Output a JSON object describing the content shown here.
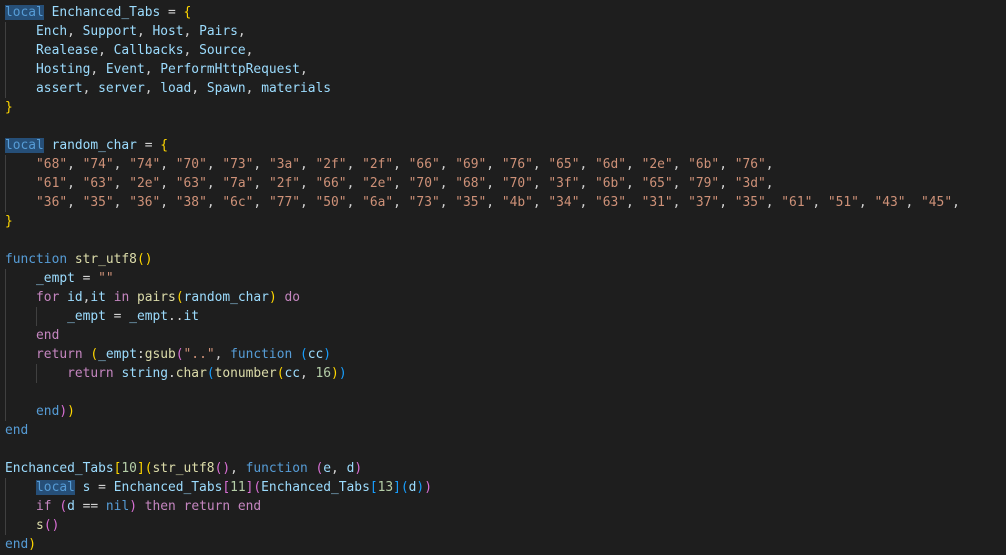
{
  "editor": {
    "lines": [
      [
        [
          "local",
          "kw hl"
        ],
        [
          " ",
          ""
        ],
        [
          "Enchanced_Tabs",
          "var"
        ],
        [
          " = ",
          ""
        ],
        [
          "{",
          "b1"
        ]
      ],
      [
        [
          "    ",
          ""
        ],
        [
          "Ench",
          "var"
        ],
        [
          ", ",
          ""
        ],
        [
          "Support",
          "var"
        ],
        [
          ", ",
          ""
        ],
        [
          "Host",
          "var"
        ],
        [
          ", ",
          ""
        ],
        [
          "Pairs",
          "var"
        ],
        [
          ",",
          ""
        ]
      ],
      [
        [
          "    ",
          ""
        ],
        [
          "Realease",
          "var"
        ],
        [
          ", ",
          ""
        ],
        [
          "Callbacks",
          "var"
        ],
        [
          ", ",
          ""
        ],
        [
          "Source",
          "var"
        ],
        [
          ",",
          ""
        ]
      ],
      [
        [
          "    ",
          ""
        ],
        [
          "Hosting",
          "var"
        ],
        [
          ", ",
          ""
        ],
        [
          "Event",
          "var"
        ],
        [
          ", ",
          ""
        ],
        [
          "PerformHttpRequest",
          "var"
        ],
        [
          ",",
          ""
        ]
      ],
      [
        [
          "    ",
          ""
        ],
        [
          "assert",
          "var"
        ],
        [
          ", ",
          ""
        ],
        [
          "server",
          "var"
        ],
        [
          ", ",
          ""
        ],
        [
          "load",
          "var"
        ],
        [
          ", ",
          ""
        ],
        [
          "Spawn",
          "var"
        ],
        [
          ", ",
          ""
        ],
        [
          "materials",
          "var"
        ]
      ],
      [
        [
          "}",
          "b1"
        ]
      ],
      [],
      [
        [
          "local",
          "kw hl"
        ],
        [
          " ",
          ""
        ],
        [
          "random_char",
          "var"
        ],
        [
          " = ",
          ""
        ],
        [
          "{",
          "b1"
        ]
      ],
      [
        [
          "    ",
          ""
        ],
        [
          "\"68\"",
          "str"
        ],
        [
          ", ",
          ""
        ],
        [
          "\"74\"",
          "str"
        ],
        [
          ", ",
          ""
        ],
        [
          "\"74\"",
          "str"
        ],
        [
          ", ",
          ""
        ],
        [
          "\"70\"",
          "str"
        ],
        [
          ", ",
          ""
        ],
        [
          "\"73\"",
          "str"
        ],
        [
          ", ",
          ""
        ],
        [
          "\"3a\"",
          "str"
        ],
        [
          ", ",
          ""
        ],
        [
          "\"2f\"",
          "str"
        ],
        [
          ", ",
          ""
        ],
        [
          "\"2f\"",
          "str"
        ],
        [
          ", ",
          ""
        ],
        [
          "\"66\"",
          "str"
        ],
        [
          ", ",
          ""
        ],
        [
          "\"69\"",
          "str"
        ],
        [
          ", ",
          ""
        ],
        [
          "\"76\"",
          "str"
        ],
        [
          ", ",
          ""
        ],
        [
          "\"65\"",
          "str"
        ],
        [
          ", ",
          ""
        ],
        [
          "\"6d\"",
          "str"
        ],
        [
          ", ",
          ""
        ],
        [
          "\"2e\"",
          "str"
        ],
        [
          ", ",
          ""
        ],
        [
          "\"6b\"",
          "str"
        ],
        [
          ", ",
          ""
        ],
        [
          "\"76\"",
          "str"
        ],
        [
          ",",
          ""
        ]
      ],
      [
        [
          "    ",
          ""
        ],
        [
          "\"61\"",
          "str"
        ],
        [
          ", ",
          ""
        ],
        [
          "\"63\"",
          "str"
        ],
        [
          ", ",
          ""
        ],
        [
          "\"2e\"",
          "str"
        ],
        [
          ", ",
          ""
        ],
        [
          "\"63\"",
          "str"
        ],
        [
          ", ",
          ""
        ],
        [
          "\"7a\"",
          "str"
        ],
        [
          ", ",
          ""
        ],
        [
          "\"2f\"",
          "str"
        ],
        [
          ", ",
          ""
        ],
        [
          "\"66\"",
          "str"
        ],
        [
          ", ",
          ""
        ],
        [
          "\"2e\"",
          "str"
        ],
        [
          ", ",
          ""
        ],
        [
          "\"70\"",
          "str"
        ],
        [
          ", ",
          ""
        ],
        [
          "\"68\"",
          "str"
        ],
        [
          ", ",
          ""
        ],
        [
          "\"70\"",
          "str"
        ],
        [
          ", ",
          ""
        ],
        [
          "\"3f\"",
          "str"
        ],
        [
          ", ",
          ""
        ],
        [
          "\"6b\"",
          "str"
        ],
        [
          ", ",
          ""
        ],
        [
          "\"65\"",
          "str"
        ],
        [
          ", ",
          ""
        ],
        [
          "\"79\"",
          "str"
        ],
        [
          ", ",
          ""
        ],
        [
          "\"3d\"",
          "str"
        ],
        [
          ",",
          ""
        ]
      ],
      [
        [
          "    ",
          ""
        ],
        [
          "\"36\"",
          "str"
        ],
        [
          ", ",
          ""
        ],
        [
          "\"35\"",
          "str"
        ],
        [
          ", ",
          ""
        ],
        [
          "\"36\"",
          "str"
        ],
        [
          ", ",
          ""
        ],
        [
          "\"38\"",
          "str"
        ],
        [
          ", ",
          ""
        ],
        [
          "\"6c\"",
          "str"
        ],
        [
          ", ",
          ""
        ],
        [
          "\"77\"",
          "str"
        ],
        [
          ", ",
          ""
        ],
        [
          "\"50\"",
          "str"
        ],
        [
          ", ",
          ""
        ],
        [
          "\"6a\"",
          "str"
        ],
        [
          ", ",
          ""
        ],
        [
          "\"73\"",
          "str"
        ],
        [
          ", ",
          ""
        ],
        [
          "\"35\"",
          "str"
        ],
        [
          ", ",
          ""
        ],
        [
          "\"4b\"",
          "str"
        ],
        [
          ", ",
          ""
        ],
        [
          "\"34\"",
          "str"
        ],
        [
          ", ",
          ""
        ],
        [
          "\"63\"",
          "str"
        ],
        [
          ", ",
          ""
        ],
        [
          "\"31\"",
          "str"
        ],
        [
          ", ",
          ""
        ],
        [
          "\"37\"",
          "str"
        ],
        [
          ", ",
          ""
        ],
        [
          "\"35\"",
          "str"
        ],
        [
          ", ",
          ""
        ],
        [
          "\"61\"",
          "str"
        ],
        [
          ", ",
          ""
        ],
        [
          "\"51\"",
          "str"
        ],
        [
          ", ",
          ""
        ],
        [
          "\"43\"",
          "str"
        ],
        [
          ", ",
          ""
        ],
        [
          "\"45\"",
          "str"
        ],
        [
          ",",
          ""
        ]
      ],
      [
        [
          "}",
          "b1"
        ]
      ],
      [],
      [
        [
          "function",
          "kw"
        ],
        [
          " ",
          ""
        ],
        [
          "str_utf8",
          "fn"
        ],
        [
          "()",
          "b1"
        ]
      ],
      [
        [
          "    ",
          ""
        ],
        [
          "_empt",
          "var"
        ],
        [
          " = ",
          ""
        ],
        [
          "\"\"",
          "str"
        ]
      ],
      [
        [
          "    ",
          ""
        ],
        [
          "for",
          "ctl"
        ],
        [
          " ",
          ""
        ],
        [
          "id",
          "var"
        ],
        [
          ",",
          ""
        ],
        [
          "it",
          "var"
        ],
        [
          " ",
          ""
        ],
        [
          "in",
          "ctl"
        ],
        [
          " ",
          ""
        ],
        [
          "pairs",
          "fn"
        ],
        [
          "(",
          "b1"
        ],
        [
          "random_char",
          "var"
        ],
        [
          ")",
          "b1"
        ],
        [
          " ",
          ""
        ],
        [
          "do",
          "ctl"
        ]
      ],
      [
        [
          "        ",
          ""
        ],
        [
          "_empt",
          "var"
        ],
        [
          " = ",
          ""
        ],
        [
          "_empt",
          "var"
        ],
        [
          "..",
          ""
        ],
        [
          "it",
          "var"
        ]
      ],
      [
        [
          "    ",
          ""
        ],
        [
          "end",
          "ctl"
        ]
      ],
      [
        [
          "    ",
          ""
        ],
        [
          "return",
          "ctl"
        ],
        [
          " ",
          ""
        ],
        [
          "(",
          "b1"
        ],
        [
          "_empt",
          "var"
        ],
        [
          ":",
          ""
        ],
        [
          "gsub",
          "fn"
        ],
        [
          "(",
          "b2"
        ],
        [
          "\"..\"",
          "str"
        ],
        [
          ", ",
          ""
        ],
        [
          "function",
          "kw"
        ],
        [
          " ",
          ""
        ],
        [
          "(",
          "b3"
        ],
        [
          "cc",
          "var"
        ],
        [
          ")",
          "b3"
        ]
      ],
      [
        [
          "        ",
          ""
        ],
        [
          "return",
          "ctl"
        ],
        [
          " ",
          ""
        ],
        [
          "string",
          "var"
        ],
        [
          ".",
          ""
        ],
        [
          "char",
          "fn"
        ],
        [
          "(",
          "b3"
        ],
        [
          "tonumber",
          "fn"
        ],
        [
          "(",
          "b1"
        ],
        [
          "cc",
          "var"
        ],
        [
          ", ",
          ""
        ],
        [
          "16",
          "num"
        ],
        [
          ")",
          "b1"
        ],
        [
          ")",
          "b3"
        ]
      ],
      [],
      [
        [
          "    ",
          ""
        ],
        [
          "end",
          "kw"
        ],
        [
          ")",
          "b2"
        ],
        [
          ")",
          "b1"
        ]
      ],
      [
        [
          "end",
          "kw"
        ]
      ],
      [],
      [
        [
          "Enchanced_Tabs",
          "var"
        ],
        [
          "[",
          "b1"
        ],
        [
          "10",
          "num"
        ],
        [
          "]",
          "b1"
        ],
        [
          "(",
          "b1"
        ],
        [
          "str_utf8",
          "fn"
        ],
        [
          "()",
          "b2"
        ],
        [
          ", ",
          ""
        ],
        [
          "function",
          "kw"
        ],
        [
          " ",
          ""
        ],
        [
          "(",
          "b2"
        ],
        [
          "e",
          "var"
        ],
        [
          ", ",
          ""
        ],
        [
          "d",
          "var"
        ],
        [
          ")",
          "b2"
        ]
      ],
      [
        [
          "    ",
          ""
        ],
        [
          "local",
          "kw hl"
        ],
        [
          " ",
          ""
        ],
        [
          "s",
          "var"
        ],
        [
          " = ",
          ""
        ],
        [
          "Enchanced_Tabs",
          "var"
        ],
        [
          "[",
          "b2"
        ],
        [
          "11",
          "num"
        ],
        [
          "]",
          "b2"
        ],
        [
          "(",
          "b2"
        ],
        [
          "Enchanced_Tabs",
          "var"
        ],
        [
          "[",
          "b3"
        ],
        [
          "13",
          "num"
        ],
        [
          "]",
          "b3"
        ],
        [
          "(",
          "b3"
        ],
        [
          "d",
          "var"
        ],
        [
          ")",
          "b3"
        ],
        [
          ")",
          "b2"
        ]
      ],
      [
        [
          "    ",
          ""
        ],
        [
          "if",
          "ctl"
        ],
        [
          " ",
          ""
        ],
        [
          "(",
          "b2"
        ],
        [
          "d",
          "var"
        ],
        [
          " == ",
          ""
        ],
        [
          "nil",
          "kw"
        ],
        [
          ")",
          "b2"
        ],
        [
          " ",
          ""
        ],
        [
          "then",
          "ctl"
        ],
        [
          " ",
          ""
        ],
        [
          "return",
          "ctl"
        ],
        [
          " ",
          ""
        ],
        [
          "end",
          "ctl"
        ]
      ],
      [
        [
          "    ",
          ""
        ],
        [
          "s",
          "fn"
        ],
        [
          "()",
          "b2"
        ]
      ],
      [
        [
          "end",
          "kw"
        ],
        [
          ")",
          "b1"
        ]
      ]
    ],
    "theme": {
      "background": "#1e1e1e",
      "selection": "#264f78",
      "keyword": "#569cd6",
      "control": "#c586c0",
      "variable": "#9cdcfe",
      "function": "#dcdcaa",
      "string": "#ce9178",
      "number": "#b5cea8",
      "bracket_1": "#ffd700",
      "bracket_2": "#da70d6",
      "bracket_3": "#179fff"
    }
  }
}
